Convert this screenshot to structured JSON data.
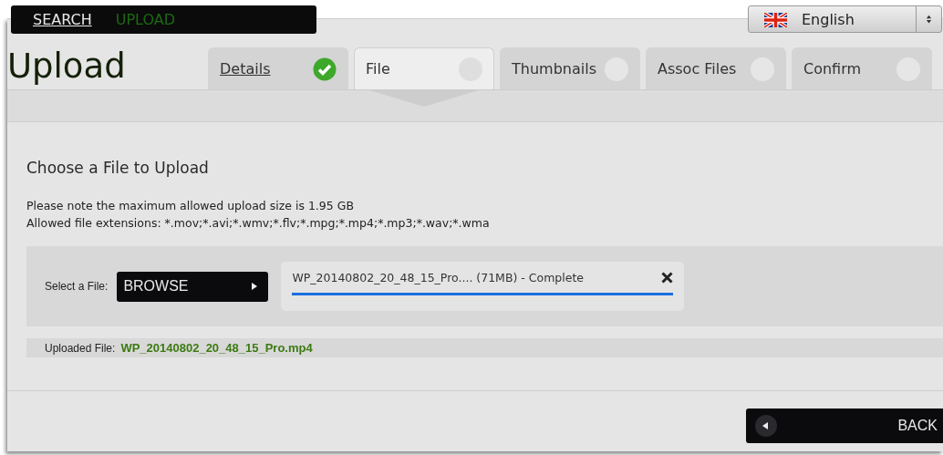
{
  "nav": [
    {
      "label": "SEARCH",
      "selected": false
    },
    {
      "label": "UPLOAD",
      "selected": true
    }
  ],
  "language": {
    "value": "English"
  },
  "title": "Upload",
  "tabs": [
    {
      "label": "Details",
      "selected": false,
      "complete": true
    },
    {
      "label": "File",
      "selected": true,
      "complete": false
    },
    {
      "label": "Thumbnails",
      "selected": false,
      "complete": false
    },
    {
      "label": "Assoc Files",
      "selected": false,
      "complete": false
    },
    {
      "label": "Confirm",
      "selected": false,
      "complete": false
    }
  ],
  "section": {
    "heading": "Choose a File to Upload",
    "notes": [
      "Please note the maximum allowed upload size is 1.95 GB",
      "Allowed file extensions: *.mov;*.avi;*.wmv;*.flv;*.mpg;*.mp4;*.mp3;*.wav;*.wma"
    ]
  },
  "picker": {
    "label": "Select a File:",
    "button": "BROWSE",
    "file": {
      "name": "WP_20140802_20_48_15_Pro.... (71MB) - Complete"
    }
  },
  "uploaded": {
    "label": "Uploaded File:",
    "value": "WP_20140802_20_48_15_Pro.mp4"
  },
  "back_button": "BACK"
}
